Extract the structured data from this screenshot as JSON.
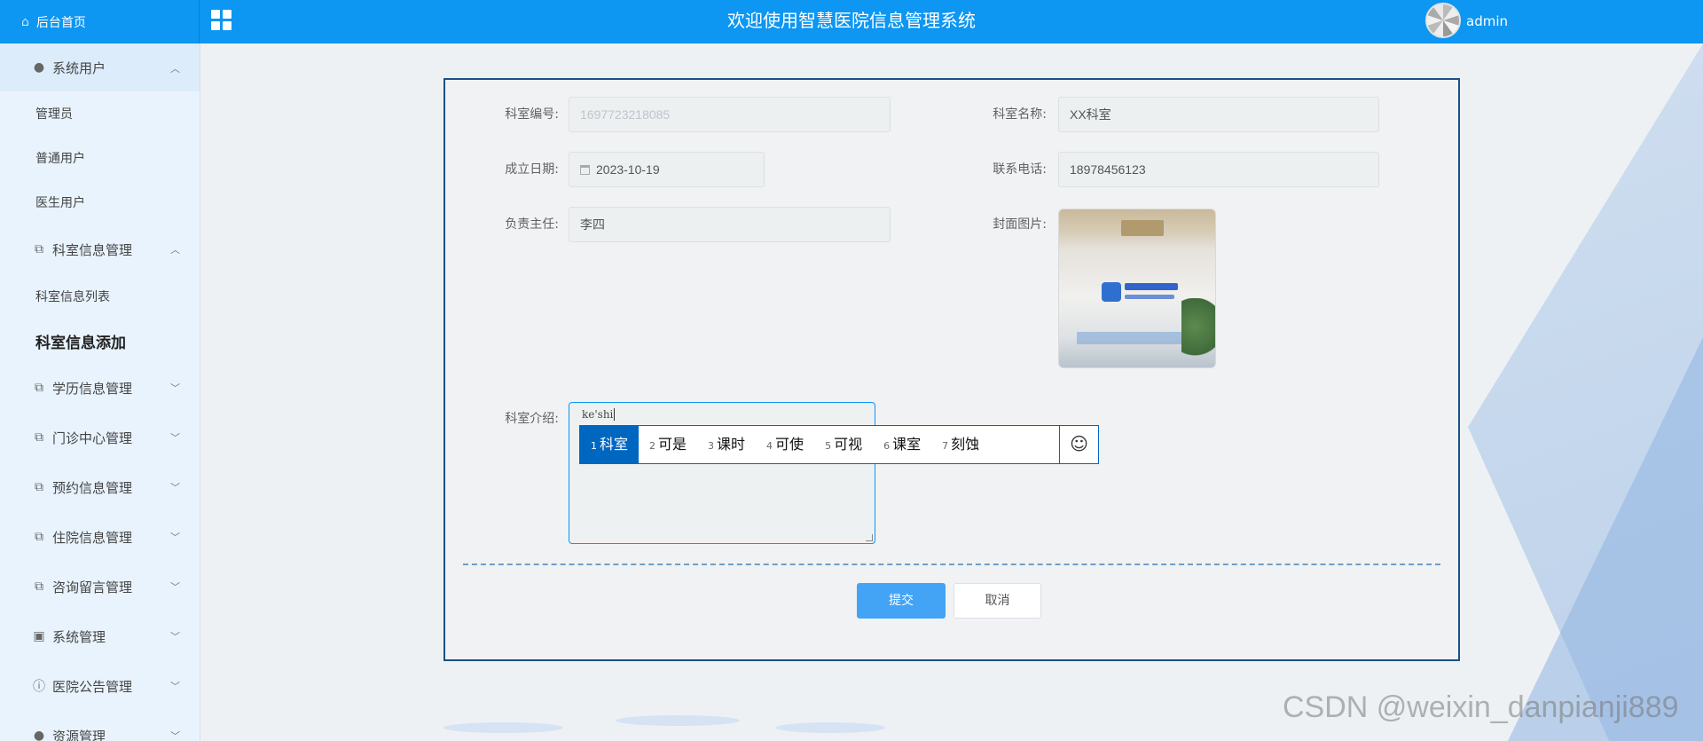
{
  "header": {
    "home_label": "后台首页",
    "title": "欢迎使用智慧医院信息管理系统",
    "username": "admin"
  },
  "sidebar": {
    "items": [
      {
        "label": "系统用户",
        "icon": "user-icon",
        "expanded": true,
        "children": [
          "管理员",
          "普通用户",
          "医生用户"
        ]
      },
      {
        "label": "科室信息管理",
        "icon": "tag-icon",
        "expanded": true,
        "children": [
          "科室信息列表",
          "科室信息添加"
        ]
      },
      {
        "label": "学历信息管理",
        "icon": "tag-icon",
        "expanded": false
      },
      {
        "label": "门诊中心管理",
        "icon": "tag-icon",
        "expanded": false
      },
      {
        "label": "预约信息管理",
        "icon": "tag-icon",
        "expanded": false
      },
      {
        "label": "住院信息管理",
        "icon": "tag-icon",
        "expanded": false
      },
      {
        "label": "咨询留言管理",
        "icon": "tag-icon",
        "expanded": false
      },
      {
        "label": "系统管理",
        "icon": "image-icon",
        "expanded": false
      },
      {
        "label": "医院公告管理",
        "icon": "info-circle-icon",
        "expanded": false
      },
      {
        "label": "资源管理",
        "icon": "circle-icon",
        "expanded": false
      }
    ],
    "active_child": "科室信息添加"
  },
  "form": {
    "dept_id_label": "科室编号:",
    "dept_id_value": "1697723218085",
    "dept_name_label": "科室名称:",
    "dept_name_value": "XX科室",
    "founded_label": "成立日期:",
    "founded_value": "2023-10-19",
    "phone_label": "联系电话:",
    "phone_value": "18978456123",
    "director_label": "负责主任:",
    "director_value": "李四",
    "cover_label": "封面图片:",
    "intro_label": "科室介绍:",
    "intro_value": "ke'shi",
    "submit_label": "提交",
    "cancel_label": "取消"
  },
  "ime": {
    "candidates": [
      {
        "n": "1",
        "w": "科室"
      },
      {
        "n": "2",
        "w": "可是"
      },
      {
        "n": "3",
        "w": "课时"
      },
      {
        "n": "4",
        "w": "可使"
      },
      {
        "n": "5",
        "w": "可视"
      },
      {
        "n": "6",
        "w": "课室"
      },
      {
        "n": "7",
        "w": "刻蚀"
      }
    ],
    "selected_index": 0,
    "emoji_icon": "smiley-icon"
  },
  "watermark": "CSDN @weixin_danpianji889",
  "colors": {
    "header": "#0d96f2",
    "sidebar": "#e8f3fd",
    "card_border": "#1b4f86",
    "primary_button": "#43a3f5",
    "ime_selected": "#0067c0"
  }
}
